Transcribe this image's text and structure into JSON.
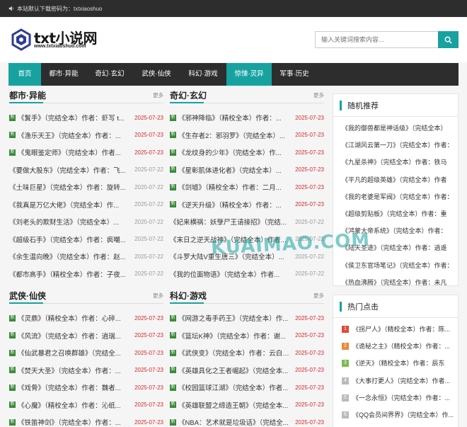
{
  "topbar": {
    "notice": "本站默认下载密码为：txtxiaoshuo"
  },
  "logo": {
    "name": "txt小说网",
    "url": "www.txtxiaoshuo.com"
  },
  "search": {
    "placeholder": "输入关键词搜索内容..."
  },
  "nav": [
    {
      "label": "首页",
      "active": true
    },
    {
      "label": "都市·异能",
      "active": false
    },
    {
      "label": "奇幻·玄幻",
      "active": false
    },
    {
      "label": "武侠·仙侠",
      "active": false
    },
    {
      "label": "科幻·游戏",
      "active": false
    },
    {
      "label": "惊悚·灵异",
      "active": true
    },
    {
      "label": "军事·历史",
      "active": false
    }
  ],
  "more_label": "更多",
  "new_badge": "新",
  "sections": [
    {
      "title": "都市·异能",
      "rows": [
        {
          "text": "《鬒手》（完结全本）作者：虾写 t...",
          "date": "2025-07-23",
          "new": true
        },
        {
          "text": "《渔乐天王》（完结全本）作者：...",
          "date": "2025-07-23",
          "new": true
        },
        {
          "text": "《鬼眼鉴定师》（完结全本）作者...",
          "date": "2025-07-23",
          "new": true
        },
        {
          "text": "《要做大股东》（完结全本）作者：飞...",
          "date": "2025-07-22",
          "new": false
        },
        {
          "text": "《土味巨星》（完结全本）作者：旋转...",
          "date": "2025-07-22",
          "new": false
        },
        {
          "text": "《我真是万亿大佬》（完结全本）作...",
          "date": "2025-07-22",
          "new": false
        },
        {
          "text": "《刘老头的欺财生活》（完结全本）...",
          "date": "2025-07-22",
          "new": false
        },
        {
          "text": "《超级石手》（完结全本）作者：疯嘲...",
          "date": "2025-07-22",
          "new": false
        },
        {
          "text": "《余生温向晚》（完结全本）作者：赵...",
          "date": "2025-07-22",
          "new": false
        },
        {
          "text": "《都市高手》（精校全本）作者：子夜...",
          "date": "2025-07-22",
          "new": false
        }
      ]
    },
    {
      "title": "奇幻·玄幻",
      "rows": [
        {
          "text": "《邪神降临》（精校全本）作者：...",
          "date": "2025-07-23",
          "new": true
        },
        {
          "text": "《生存者2：邪羽罗》（完结全本）...",
          "date": "2025-07-23",
          "new": true
        },
        {
          "text": "《龙纹身的少年》（完结全本）作...",
          "date": "2025-07-23",
          "new": true
        },
        {
          "text": "《星彰肌体进化者》（完结全本）...",
          "date": "2025-07-23",
          "new": true
        },
        {
          "text": "《剑墟》（精校全本）作者：二月...",
          "date": "2025-07-23",
          "new": true
        },
        {
          "text": "《逆天升级》（精校全本）作者：...",
          "date": "2025-07-23",
          "new": true
        },
        {
          "text": "《妃来横祸：妖孽尸王请接招》（完结...",
          "date": "2025-07-22",
          "new": false
        },
        {
          "text": "《末日之逆天战神》（完结全本）作者...",
          "date": "2025-07-22",
          "new": false
        },
        {
          "text": "《斗罗大陆V重生唐三》（完结全本）...",
          "date": "2025-07-22",
          "new": false
        },
        {
          "text": "《我的位面物语》（完结全本）作者...",
          "date": "2025-07-22",
          "new": false
        }
      ]
    },
    {
      "title": "武侠·仙侠",
      "rows": [
        {
          "text": "《灵鼎》（精校全本）作者：心碎...",
          "date": "2025-07-23",
          "new": true
        },
        {
          "text": "《风流》（完结全本）作者：逍瑞...",
          "date": "2025-07-23",
          "new": true
        },
        {
          "text": "《仙武暴君之召唤群雄》（完结全...",
          "date": "2025-07-23",
          "new": true
        },
        {
          "text": "《焚天大圣》（完结全本）作者：...",
          "date": "2025-07-23",
          "new": true
        },
        {
          "text": "《戏骨》（完结全本）作者：魏者...",
          "date": "2025-07-23",
          "new": true
        },
        {
          "text": "《心魔》（精校全本）作者：沁纸...",
          "date": "2025-07-23",
          "new": true
        },
        {
          "text": "《铁笛神剑》（完结全本）作者：...",
          "date": "2025-07-23",
          "new": true
        }
      ]
    },
    {
      "title": "科幻·游戏",
      "rows": [
        {
          "text": "《网游之毒手药王》（完结全本）作...",
          "date": "2025-07-23",
          "new": true
        },
        {
          "text": "《篮坛K神》（完结全本）作者：谢...",
          "date": "2025-07-23",
          "new": true
        },
        {
          "text": "《武侠变》（完结全本）作者：云白天...",
          "date": "2025-07-23",
          "new": true
        },
        {
          "text": "《英雄具化之王者崛起》（完结全本...",
          "date": "2025-07-23",
          "new": true
        },
        {
          "text": "《校园篮球江湖》（完结全本）作者...",
          "date": "2025-07-23",
          "new": true
        },
        {
          "text": "《英雄联盟之缔造王朝》（完结全本...",
          "date": "2025-07-23",
          "new": true
        },
        {
          "text": "《NBA：艺术就是垃圾话》（完结全...",
          "date": "2025-07-23",
          "new": true
        }
      ]
    }
  ],
  "random": {
    "title": "随机推荐",
    "items": [
      "《我的御兽都是神话级》（完结全本）",
      "《江湖风云第一刀》（完结全本）作者：",
      "《九星杀神》（完结全本）作者：铁马",
      "《平凡的超级英雄》（完结全本）作者",
      "《我的老婆是军阀》（完结全本）作者：",
      "《超级剪贴板》（完结全本）作者：重",
      "《鸿蒙大帝系统》（完结全本）作者：",
      "《陆天圣途》（完结全本）作者：逍遥",
      "《侯卫东官场笔记》（完结全本）作者：",
      "《热血沸腾》（完结全本）作者：未凡"
    ]
  },
  "hot": {
    "title": "热门点击",
    "colors": [
      "#e04a3a",
      "#e8893a",
      "#7cba4a",
      "#bbbbbb",
      "#bbbbbb",
      "#bbbbbb",
      "#bbbbbb"
    ],
    "items": [
      {
        "num": "1",
        "text": "《拐尸人》（精校全本）作者：陈..."
      },
      {
        "num": "2",
        "text": "《诡秘之主》（精校全本）作者：..."
      },
      {
        "num": "3",
        "text": "《逆天》（精校全本）作者：辰东"
      },
      {
        "num": "4",
        "text": "《大事打更人》（完结全本）作者..."
      },
      {
        "num": "5",
        "text": "《一念永恒》（完结全本）作者：..."
      },
      {
        "num": "6",
        "text": "《QQ会员间界界》（完结全本）作..."
      },
      {
        "num": "7",
        "text": "《杂届之主》（精校全本）作者："
      }
    ]
  },
  "watermark": "KUAIMAO.COM"
}
